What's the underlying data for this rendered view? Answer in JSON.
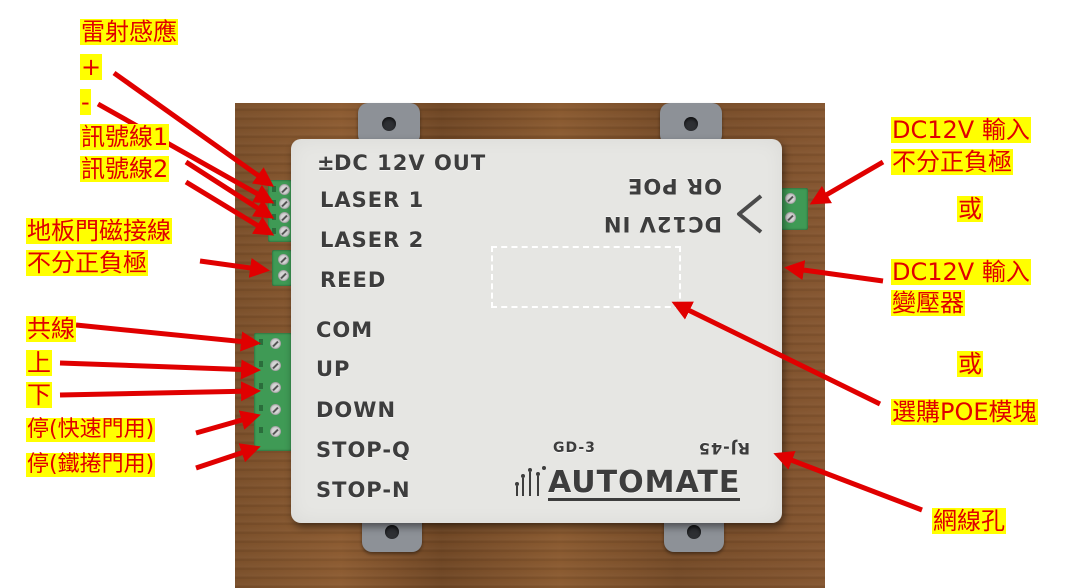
{
  "left_labels": {
    "laser_sensor": "雷射感應",
    "plus": "+",
    "minus": "-",
    "signal_wire_1": "訊號線1",
    "signal_wire_2": "訊號線2",
    "reed_line_1": "地板門磁接線",
    "reed_line_2": "不分正負極",
    "common": "共線",
    "up": "上",
    "down": "下",
    "stop_fast_door": "停(快速門用)",
    "stop_rolling_door": "停(鐵捲門用)"
  },
  "right_labels": {
    "dc_input_1": "DC12V 輸入",
    "no_polarity": "不分正負極",
    "or_1": "或",
    "dc_input_2": "DC12V 輸入",
    "transformer": "變壓器",
    "or_2": "或",
    "poe_module": "選購POE模塊",
    "network_port": "網線孔"
  },
  "device": {
    "dc_out": "DC 12V OUT",
    "dc_out_sign": "±",
    "laser1": "LASER 1",
    "laser2": "LASER 2",
    "reed": "REED",
    "com": "COM",
    "up": "UP",
    "down": "DOWN",
    "stop_q": "STOP-Q",
    "stop_n": "STOP-N",
    "dc_in": "DC12V IN",
    "or_poe": "OR POE",
    "model": "GD-3",
    "rj45": "RJ-45",
    "brand": "AUTOMATE"
  },
  "colors": {
    "annotation_text": "#e00000",
    "annotation_highlight": "#ffff00",
    "arrow": "#e00000",
    "terminal_block": "#3f9a55",
    "enclosure": "#e6e6e3"
  }
}
